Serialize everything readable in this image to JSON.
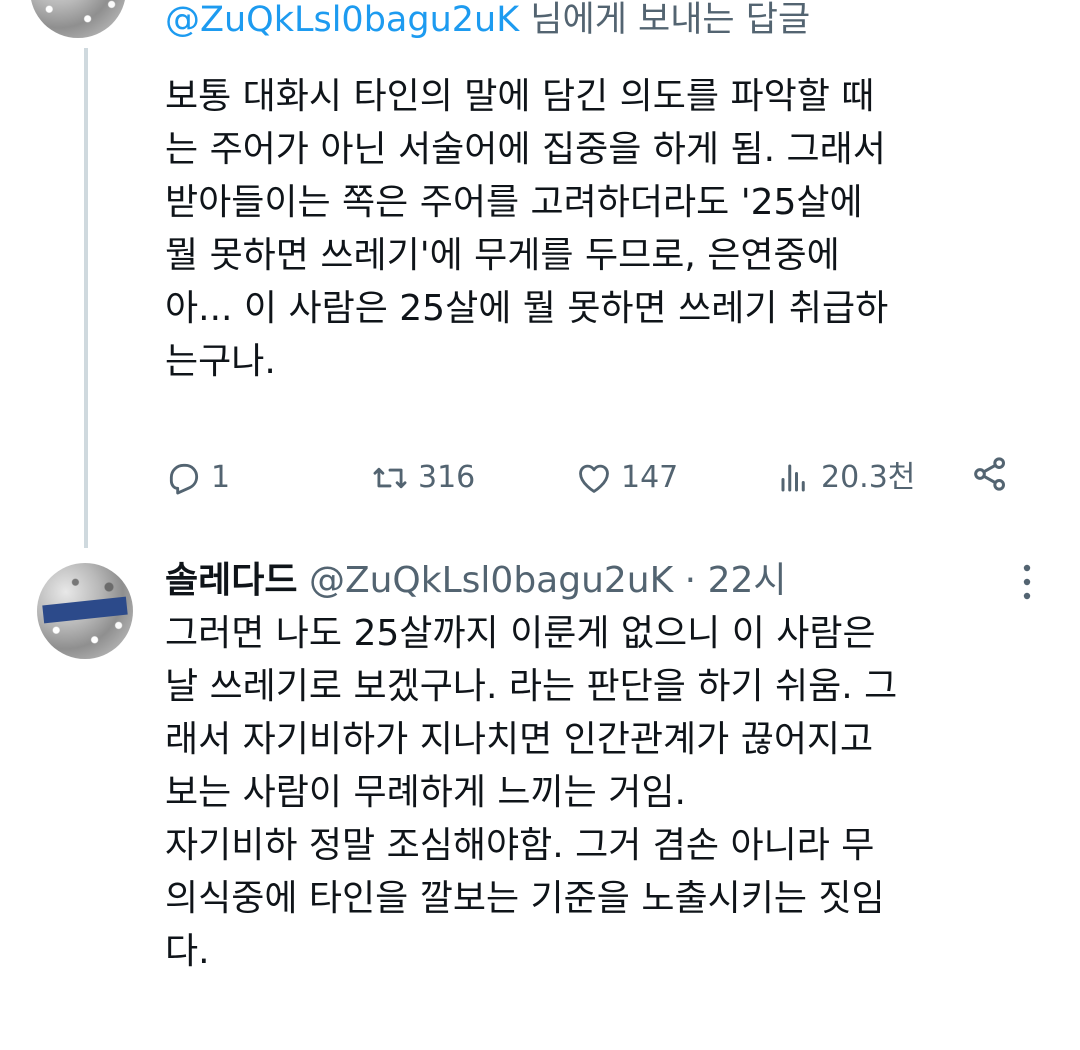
{
  "reply_context": {
    "mention": "@ZuQkLsl0bagu2uK",
    "suffix": " 님에게 보내는 답글"
  },
  "tweet1": {
    "text": "보통 대화시 타인의 말에 담긴 의도를 파악할 때\n는 주어가 아닌 서술어에 집중을 하게 됨. 그래서\n받아들이는 쪽은 주어를 고려하더라도 '25살에\n뭘 못하면 쓰레기'에 무게를 두므로, 은연중에\n아... 이 사람은 25살에 뭘 못하면 쓰레기 취급하\n는구나.",
    "actions": {
      "replies": "1",
      "retweets": "316",
      "likes": "147",
      "views": "20.3천"
    },
    "icons": {
      "reply": "reply-icon",
      "retweet": "retweet-icon",
      "like": "heart-icon",
      "views": "views-icon",
      "share": "share-icon"
    }
  },
  "tweet2": {
    "author_name": "솔레다드",
    "handle": "@ZuQkLsl0bagu2uK",
    "separator": " · ",
    "time": "22시",
    "text": "그러면 나도 25살까지 이룬게 없으니 이 사람은\n날 쓰레기로 보겠구나. 라는 판단을 하기 쉬움. 그\n래서 자기비하가 지나치면 인간관계가 끊어지고\n보는 사람이 무례하게 느끼는 거임.\n자기비하 정말 조심해야함. 그거 겸손 아니라 무\n의식중에 타인을 깔보는 기준을 노출시키는 짓임\n다."
  },
  "colors": {
    "text": "#0f1419",
    "secondary": "#536471",
    "link": "#1d9bf0",
    "thread_line": "#cfd9de"
  }
}
